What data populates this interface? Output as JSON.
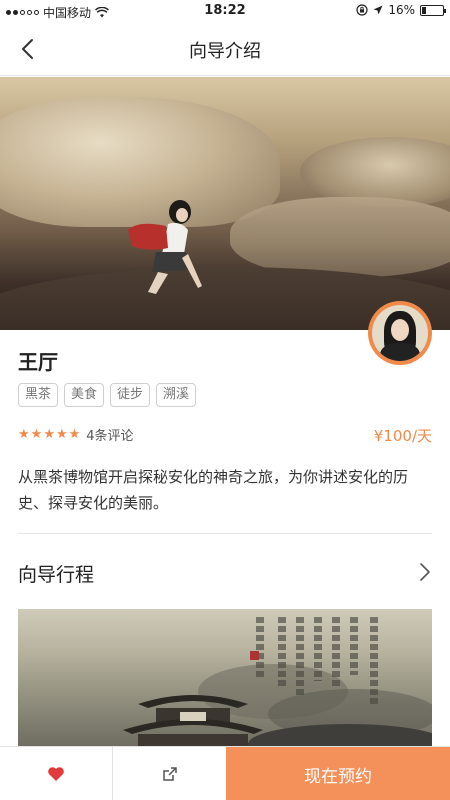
{
  "status_bar": {
    "carrier": "中国移动",
    "time": "18:22",
    "battery": "16%",
    "battery_level": 0.16
  },
  "nav": {
    "title": "向导介绍",
    "back_icon": "chevron-left-icon"
  },
  "guide": {
    "name": "王厅",
    "tags": [
      "黑茶",
      "美食",
      "徒步",
      "溯溪"
    ],
    "rating_stars": 5,
    "reviews": "4条评论",
    "price": "¥100/天",
    "description": "从黑茶博物馆开启探秘安化的神奇之旅，为你讲述安化的历史、探寻安化的美丽。"
  },
  "section": {
    "title": "向导行程",
    "arrow_icon": "chevron-right-icon"
  },
  "bottom_bar": {
    "favorite_icon": "heart-icon",
    "share_icon": "share-icon",
    "book_label": "现在预约"
  },
  "colors": {
    "accent": "#f08a4b",
    "book_button": "#f4905a",
    "heart": "#e23b3b"
  }
}
